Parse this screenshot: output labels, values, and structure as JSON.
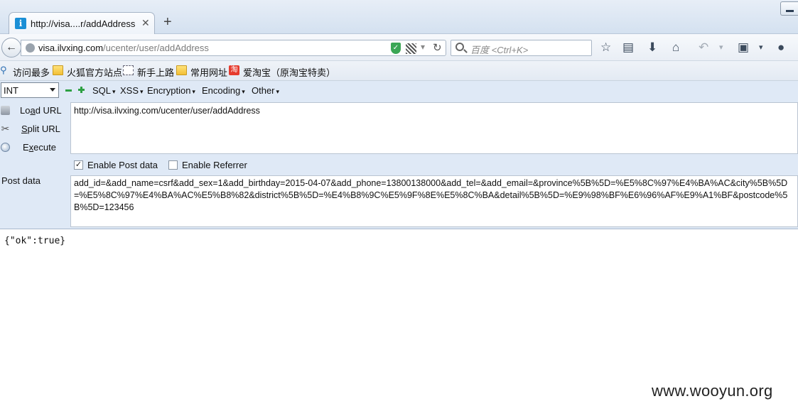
{
  "tab": {
    "title": "http://visa....r/addAddress",
    "close": "✕",
    "new": "+"
  },
  "navbar": {
    "url_host": "visa.ilvxing.com",
    "url_path": "/ucenter/user/addAddress",
    "search_placeholder": "百度 <Ctrl+K>"
  },
  "bookmarks": [
    {
      "label": "访问最多"
    },
    {
      "label": "火狐官方站点"
    },
    {
      "label": "新手上路"
    },
    {
      "label": "常用网址"
    },
    {
      "label": "爱淘宝（原淘宝特卖）",
      "icon_text": "淘"
    }
  ],
  "hackbar": {
    "select_value": "INT",
    "menus": [
      "SQL",
      "XSS",
      "Encryption",
      "Encoding",
      "Other"
    ],
    "actions": [
      {
        "pre": "Lo",
        "key": "a",
        "post": "d URL"
      },
      {
        "pre": "",
        "key": "S",
        "post": "plit URL"
      },
      {
        "pre": "E",
        "key": "x",
        "post": "ecute"
      }
    ],
    "url_value": "http://visa.ilvxing.com/ucenter/user/addAddress",
    "enable_post_label": "Enable Post data",
    "enable_post_checked": true,
    "enable_referrer_label": "Enable Referrer",
    "enable_referrer_checked": false,
    "post_label": "Post data",
    "post_value": "add_id=&add_name=csrf&add_sex=1&add_birthday=2015-04-07&add_phone=13800138000&add_tel=&add_email=&province%5B%5D=%E5%8C%97%E4%BA%AC&city%5B%5D=%E5%8C%97%E4%BA%AC%E5%B8%82&district%5B%5D=%E4%B8%9C%E5%9F%8E%E5%8C%BA&detail%5B%5D=%E9%98%BF%E6%96%AF%E9%A1%BF&postcode%5B%5D=123456"
  },
  "response": "{\"ok\":true}",
  "watermark": "www.wooyun.org",
  "colors": {
    "chrome": "#dfe9f6",
    "shield": "#3aa655",
    "hackbar_plus": "#2ea043"
  }
}
